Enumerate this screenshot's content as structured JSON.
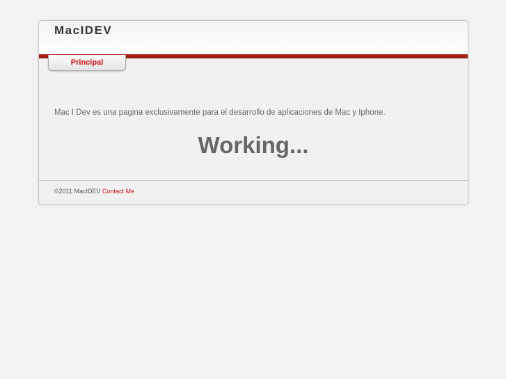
{
  "header": {
    "logo": "MacIDEV"
  },
  "nav": {
    "tabs": [
      {
        "label": "Principal"
      }
    ]
  },
  "main": {
    "intro": "Mac I Dev es una pagina exclusivamente para el desarrollo de aplicaciones de Mac y Iphone.",
    "heading": "Working..."
  },
  "footer": {
    "copyright": "©2011 MacIDEV",
    "contact_link": "Contact Me"
  },
  "colors": {
    "accent": "#d0101a",
    "bar": "#a52016"
  }
}
